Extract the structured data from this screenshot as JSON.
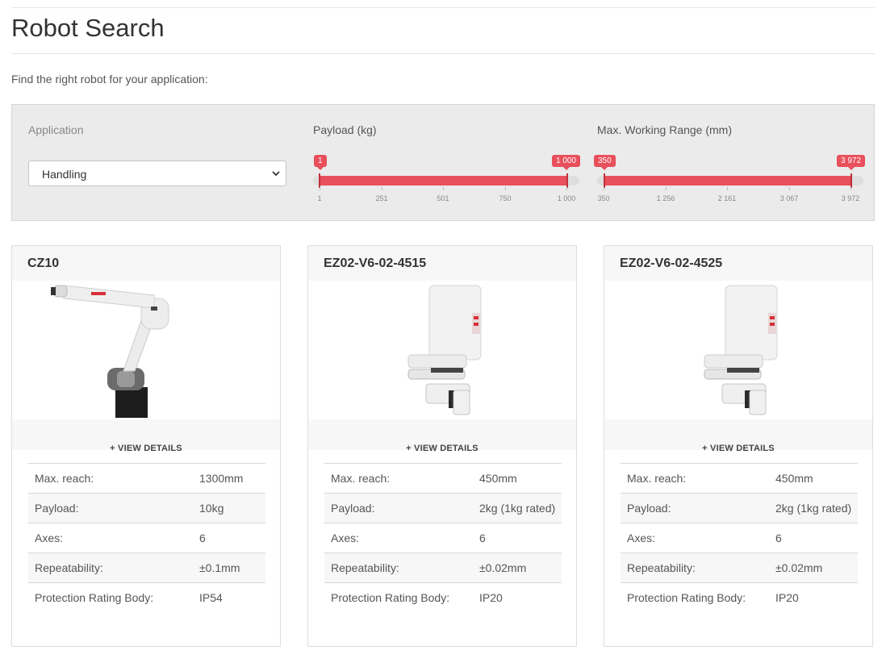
{
  "page": {
    "title": "Robot Search",
    "intro": "Find the right robot for your application:"
  },
  "filters": {
    "application": {
      "label": "Application",
      "value": "Handling"
    },
    "payload": {
      "label": "Payload (kg)",
      "min_value": "1",
      "max_value": "1 000",
      "ticks": [
        "1",
        "251",
        "501",
        "750",
        "1 000"
      ]
    },
    "range": {
      "label": "Max. Working Range (mm)",
      "min_value": "350",
      "max_value": "3 972",
      "ticks": [
        "350",
        "1 256",
        "2 161",
        "3 067",
        "3 972"
      ]
    },
    "accent_color": "#e8505b"
  },
  "details_label": "VIEW DETAILS",
  "cards": [
    {
      "name": "CZ10",
      "specs": [
        {
          "k": "Max. reach:",
          "v": "1300mm"
        },
        {
          "k": "Payload:",
          "v": "10kg"
        },
        {
          "k": "Axes:",
          "v": "6"
        },
        {
          "k": "Repeatability:",
          "v": "±0.1mm"
        },
        {
          "k": "Protection Rating Body:",
          "v": "IP54"
        }
      ]
    },
    {
      "name": "EZ02-V6-02-4515",
      "specs": [
        {
          "k": "Max. reach:",
          "v": "450mm"
        },
        {
          "k": "Payload:",
          "v": "2kg (1kg rated)"
        },
        {
          "k": "Axes:",
          "v": "6"
        },
        {
          "k": "Repeatability:",
          "v": "±0.02mm"
        },
        {
          "k": "Protection Rating Body:",
          "v": "IP20"
        }
      ]
    },
    {
      "name": "EZ02-V6-02-4525",
      "specs": [
        {
          "k": "Max. reach:",
          "v": "450mm"
        },
        {
          "k": "Payload:",
          "v": "2kg (1kg rated)"
        },
        {
          "k": "Axes:",
          "v": "6"
        },
        {
          "k": "Repeatability:",
          "v": "±0.02mm"
        },
        {
          "k": "Protection Rating Body:",
          "v": "IP20"
        }
      ]
    }
  ]
}
